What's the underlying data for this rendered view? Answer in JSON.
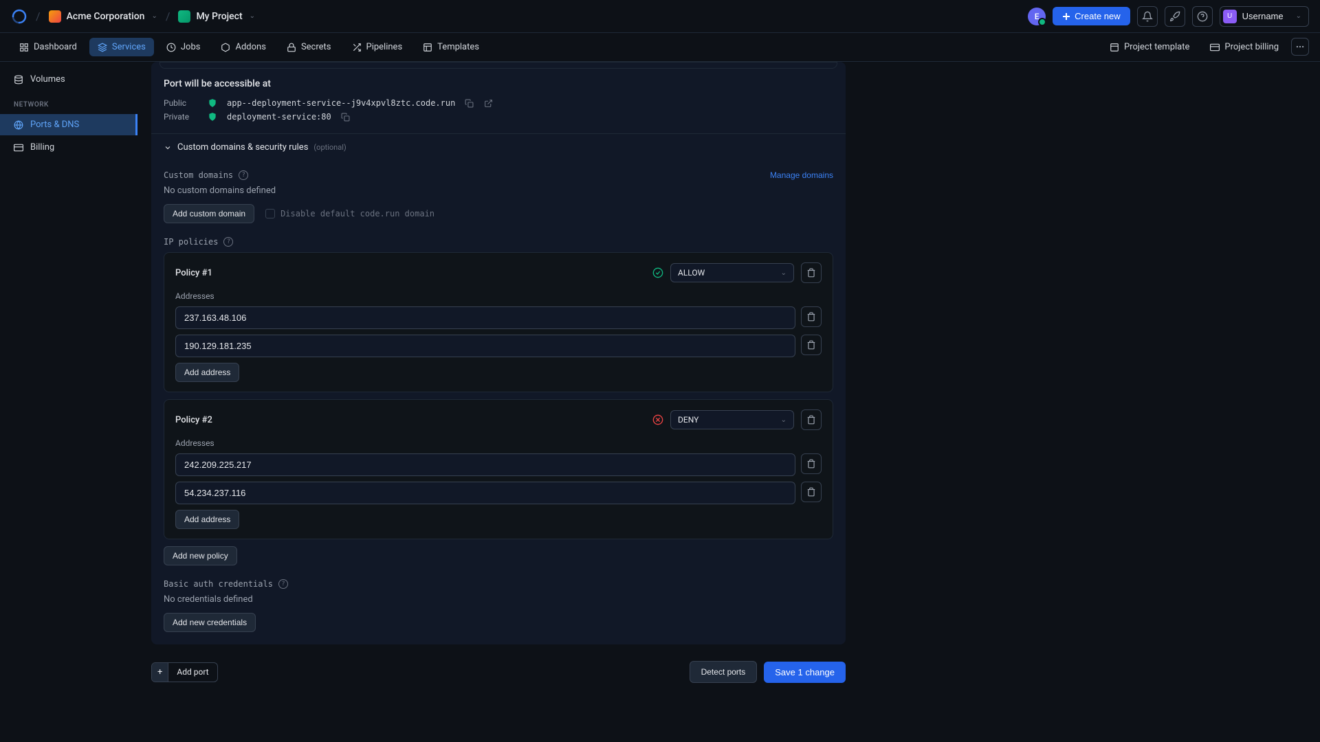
{
  "topbar": {
    "org": "Acme Corporation",
    "project": "My Project",
    "avatar_initial": "E",
    "create_new": "Create new",
    "username": "Username",
    "user_initial": "U"
  },
  "tabs": {
    "dashboard": "Dashboard",
    "services": "Services",
    "jobs": "Jobs",
    "addons": "Addons",
    "secrets": "Secrets",
    "pipelines": "Pipelines",
    "templates": "Templates",
    "project_template": "Project template",
    "project_billing": "Project billing"
  },
  "sidebar": {
    "volumes": "Volumes",
    "network_header": "NETWORK",
    "ports_dns": "Ports & DNS",
    "billing": "Billing"
  },
  "port_section": {
    "title": "Port will be accessible at",
    "public_label": "Public",
    "public_url": "app--deployment-service--j9v4xpvl8ztc.code.run",
    "private_label": "Private",
    "private_url": "deployment-service:80"
  },
  "custom_domains": {
    "header": "Custom domains & security rules",
    "optional": "(optional)",
    "label": "Custom domains",
    "manage": "Manage domains",
    "empty": "No custom domains defined",
    "add_btn": "Add custom domain",
    "disable_default": "Disable default code.run domain"
  },
  "ip_policies": {
    "label": "IP policies",
    "policies": [
      {
        "title": "Policy #1",
        "action": "ALLOW",
        "addresses_label": "Addresses",
        "addresses": [
          "237.163.48.106",
          "190.129.181.235"
        ],
        "add_address": "Add address"
      },
      {
        "title": "Policy #2",
        "action": "DENY",
        "addresses_label": "Addresses",
        "addresses": [
          "242.209.225.217",
          "54.234.237.116"
        ],
        "add_address": "Add address"
      }
    ],
    "add_policy": "Add new policy"
  },
  "basic_auth": {
    "label": "Basic auth credentials",
    "empty": "No credentials defined",
    "add_btn": "Add new credentials"
  },
  "bottom": {
    "add_port": "Add port",
    "detect_ports": "Detect ports",
    "save": "Save 1 change"
  }
}
